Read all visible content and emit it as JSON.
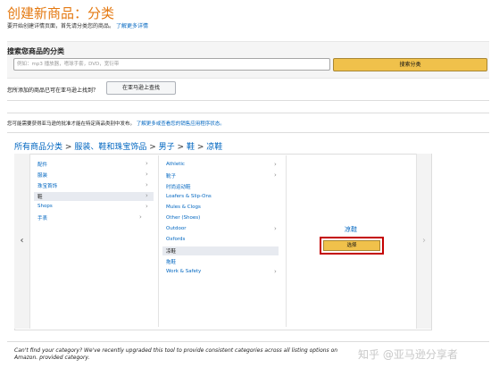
{
  "header": {
    "title": "创建新商品：分类",
    "subtitle": "要开始创建详情页面，首先请分类您的商品。",
    "subtitle_link": "了解更多详情"
  },
  "search": {
    "label": "搜索您商品的分类",
    "placeholder": "例如：mp3 播放器，嗜球手套，DVD，宽衍带",
    "button_label": "搜索分类"
  },
  "sell_check": {
    "question": "您所添加的商品已可在亚马逊上找到？",
    "button_label": "在亚马逊上查找"
  },
  "info": {
    "text": "您可能需要获得亚马逊的批准才能在特定商品类别中发布。",
    "link": "了解更多或查看您的销售应用程序状态。"
  },
  "breadcrumb": {
    "items": [
      "所有商品分类",
      "服装、鞋和珠宝饰品",
      "男子",
      "鞋",
      "凉鞋"
    ],
    "separator": ">"
  },
  "browser": {
    "nav_left": "‹",
    "nav_right": "›",
    "column1": [
      {
        "label": "配件",
        "has_children": true,
        "selected": false
      },
      {
        "label": "服装",
        "has_children": true,
        "selected": false
      },
      {
        "label": "珠宝首饰",
        "has_children": true,
        "selected": false
      },
      {
        "label": "鞋",
        "has_children": true,
        "selected": true
      },
      {
        "label": "Shops",
        "has_children": true,
        "selected": false
      },
      {
        "label": "手表",
        "has_children": true,
        "selected": false
      }
    ],
    "column2": [
      {
        "label": "Athletic",
        "has_children": true,
        "selected": false
      },
      {
        "label": "靴子",
        "has_children": true,
        "selected": false
      },
      {
        "label": "时尚运动鞋",
        "has_children": false,
        "selected": false
      },
      {
        "label": "Loafers & Slip-Ons",
        "has_children": false,
        "selected": false
      },
      {
        "label": "Mules & Clogs",
        "has_children": false,
        "selected": false
      },
      {
        "label": "Other (Shoes)",
        "has_children": false,
        "selected": false
      },
      {
        "label": "Outdoor",
        "has_children": true,
        "selected": false
      },
      {
        "label": "Oxfords",
        "has_children": false,
        "selected": false
      },
      {
        "label": "凉鞋",
        "has_children": false,
        "selected": true
      },
      {
        "label": "拖鞋",
        "has_children": false,
        "selected": false
      },
      {
        "label": "Work & Safety",
        "has_children": true,
        "selected": false
      }
    ],
    "detail": {
      "title": "凉鞋",
      "select_label": "选择"
    }
  },
  "footer": {
    "note": "Can't find your category? We've recently upgraded this tool to provide consistent categories across all listing options on Amazon. provided category."
  },
  "watermark": "知乎 @亚马逊分享者",
  "colors": {
    "accent_orange": "#e47911",
    "link_blue": "#0066c0",
    "button_yellow": "#f0c14b",
    "highlight_red": "#c40000"
  }
}
